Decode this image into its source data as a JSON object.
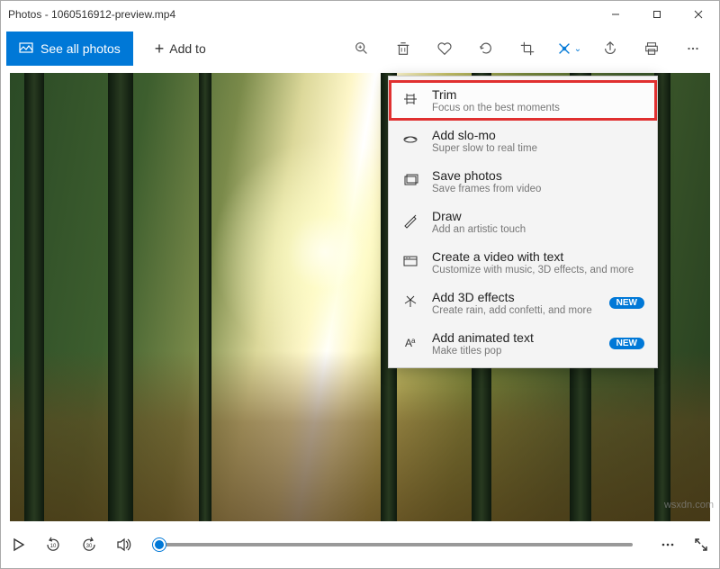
{
  "titlebar": {
    "title": "Photos - 1060516912-preview.mp4"
  },
  "toolbar": {
    "see_all_label": "See all photos",
    "add_to_label": "Add to"
  },
  "edit_menu": {
    "items": [
      {
        "title": "Trim",
        "subtitle": "Focus on the best moments",
        "icon": "trim-icon",
        "highlighted": true
      },
      {
        "title": "Add slo-mo",
        "subtitle": "Super slow to real time",
        "icon": "slomo-icon"
      },
      {
        "title": "Save photos",
        "subtitle": "Save frames from video",
        "icon": "save-photos-icon"
      },
      {
        "title": "Draw",
        "subtitle": "Add an artistic touch",
        "icon": "draw-icon"
      },
      {
        "title": "Create a video with text",
        "subtitle": "Customize with music, 3D effects, and more",
        "icon": "video-text-icon"
      },
      {
        "title": "Add 3D effects",
        "subtitle": "Create rain, add confetti, and more",
        "icon": "effects-3d-icon",
        "badge": "NEW"
      },
      {
        "title": "Add animated text",
        "subtitle": "Make titles pop",
        "icon": "animated-text-icon",
        "badge": "NEW"
      }
    ]
  },
  "watermark": "wsxdn.com"
}
